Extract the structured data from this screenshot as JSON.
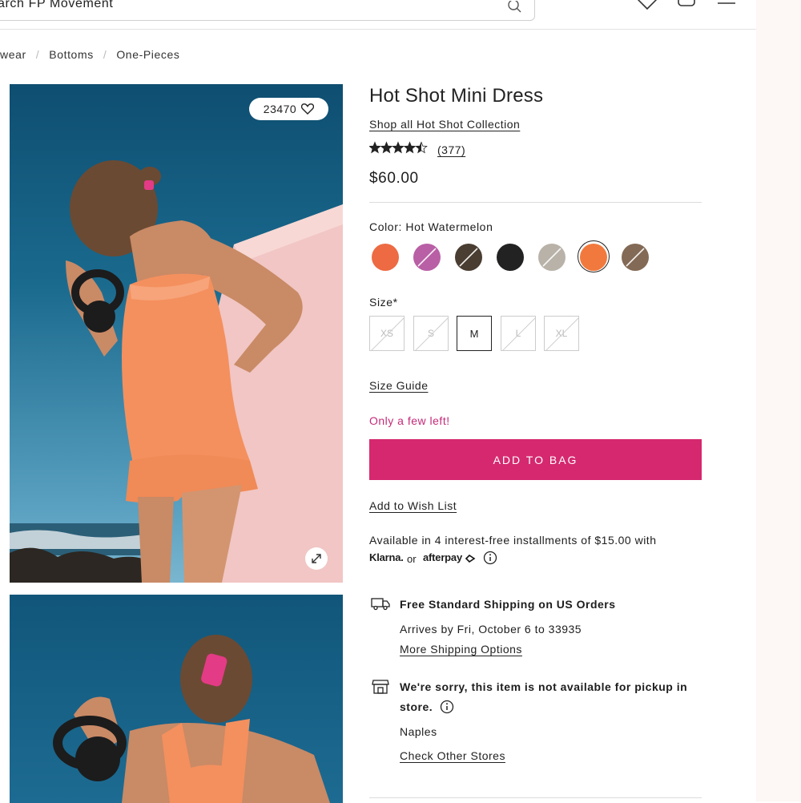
{
  "header": {
    "search_value": "arch FP Movement"
  },
  "breadcrumb": [
    "wear",
    "Bottoms",
    "One-Pieces"
  ],
  "gallery": {
    "like_count": "23470"
  },
  "product": {
    "title": "Hot Shot Mini Dress",
    "collection_link": "Shop all Hot Shot Collection",
    "rating_value": 4.5,
    "rating_stars": "★★★★½",
    "reviews": "(377)",
    "price": "$60.00"
  },
  "color": {
    "label": "Color: Hot Watermelon",
    "swatches": [
      {
        "color": "#ed6a43",
        "unavailable": false
      },
      {
        "color": "#b95fa5",
        "unavailable": true
      },
      {
        "color": "#4a3d31",
        "unavailable": true
      },
      {
        "color": "#222222",
        "unavailable": false
      },
      {
        "color": "#b8b2a8",
        "unavailable": true
      },
      {
        "color": "#f2793d",
        "unavailable": false,
        "selected": true
      },
      {
        "color": "#836a56",
        "unavailable": true
      }
    ]
  },
  "size": {
    "label": "Size*",
    "options": [
      {
        "label": "XS",
        "available": false
      },
      {
        "label": "S",
        "available": false
      },
      {
        "label": "M",
        "available": true,
        "selected": true
      },
      {
        "label": "L",
        "available": false
      },
      {
        "label": "XL",
        "available": false
      }
    ]
  },
  "size_guide": "Size Guide",
  "stock_message": "Only a few left!",
  "add_to_bag": "ADD TO BAG",
  "wishlist": "Add to Wish List",
  "installments": {
    "text": "Available in 4 interest-free installments of $15.00 with",
    "klarna": "Klarna.",
    "or": "or",
    "afterpay": "afterpay"
  },
  "shipping": {
    "title": "Free Standard Shipping on US Orders",
    "arrives": "Arrives by Fri, October 6 to 33935",
    "more": "More Shipping Options"
  },
  "pickup": {
    "line1": "We're sorry, this item is not available for pickup in",
    "line2": "store.",
    "store": "Naples",
    "check": "Check Other Stores"
  },
  "colors": {
    "brand_pink": "#d5286f",
    "stock_pink": "#c52a78"
  }
}
